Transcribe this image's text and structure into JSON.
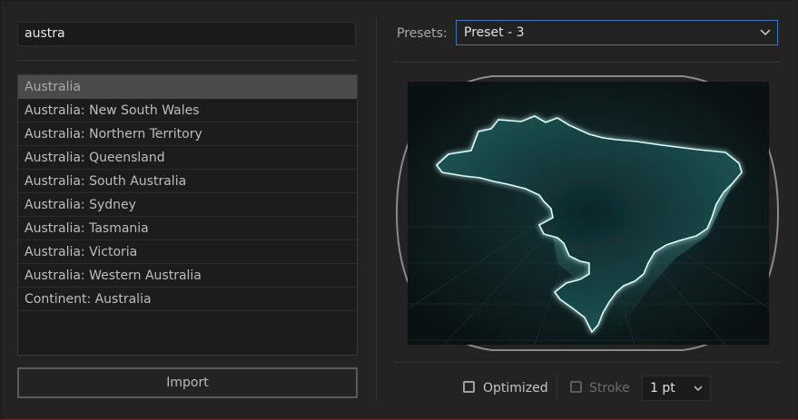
{
  "search": {
    "value": "austra"
  },
  "results": [
    {
      "label": "Australia",
      "selected": true
    },
    {
      "label": "Australia: New South Wales"
    },
    {
      "label": "Australia: Northern Territory"
    },
    {
      "label": "Australia: Queensland"
    },
    {
      "label": "Australia: South Australia"
    },
    {
      "label": "Australia: Sydney"
    },
    {
      "label": "Australia: Tasmania"
    },
    {
      "label": "Australia: Victoria"
    },
    {
      "label": "Australia: Western Australia"
    },
    {
      "label": "Continent: Australia"
    }
  ],
  "import_label": "Import",
  "presets": {
    "label": "Presets:",
    "selected": "Preset - 3"
  },
  "options": {
    "optimized_label": "Optimized",
    "optimized_checked": false,
    "stroke_label": "Stroke",
    "stroke_checked": false,
    "stroke_enabled": false,
    "stroke_width": "1 pt"
  },
  "icons": {
    "preset_dropdown": "chevron-down-icon",
    "stroke_dropdown": "chevron-down-icon"
  },
  "colors": {
    "accent": "#3d74c4",
    "map_glow": "#3fc6c0",
    "preview_bg": "#0d1516"
  }
}
